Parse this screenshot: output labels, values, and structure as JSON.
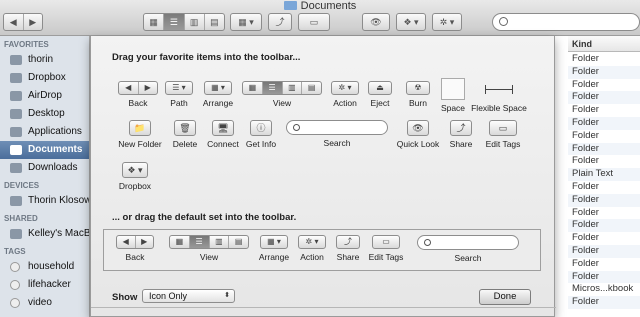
{
  "window": {
    "title": "Documents"
  },
  "toolbar": {
    "back_forward": [
      "◀",
      "▶"
    ],
    "view_modes": [
      "▦",
      "☰",
      "▥",
      "▤"
    ],
    "arrange_label": "▦ ▾",
    "share_label": "⤴",
    "tags_label": "▭",
    "quicklook_label": "👁",
    "dropbox_label": "❖ ▾",
    "action_label": "✲ ▾"
  },
  "sidebar": {
    "favorites_header": "FAVORITES",
    "favorites": [
      {
        "label": "thorin"
      },
      {
        "label": "Dropbox"
      },
      {
        "label": "AirDrop"
      },
      {
        "label": "Desktop"
      },
      {
        "label": "Applications"
      },
      {
        "label": "Documents"
      },
      {
        "label": "Downloads"
      }
    ],
    "devices_header": "DEVICES",
    "devices": [
      {
        "label": "Thorin Klosow..."
      }
    ],
    "shared_header": "SHARED",
    "shared": [
      {
        "label": "Kelley's MacBo..."
      }
    ],
    "tags_header": "TAGS",
    "tags": [
      {
        "label": "household"
      },
      {
        "label": "lifehacker"
      },
      {
        "label": "video"
      }
    ]
  },
  "list": {
    "kind_header": "Kind",
    "kinds": [
      "Folder",
      "Folder",
      "Folder",
      "Folder",
      "Folder",
      "Folder",
      "Folder",
      "Folder",
      "Folder",
      "Plain Text",
      "Folder",
      "Folder",
      "Folder",
      "Folder",
      "Folder",
      "Folder",
      "Folder",
      "Folder",
      "Micros...kbook",
      "Folder"
    ]
  },
  "customize": {
    "heading": "Drag your favorite items into the toolbar...",
    "default_heading": "... or drag the default set into the toolbar.",
    "items": {
      "back": "Back",
      "path": "Path",
      "arrange": "Arrange",
      "view": "View",
      "action": "Action",
      "eject": "Eject",
      "burn": "Burn",
      "space": "Space",
      "flexible_space": "Flexible Space",
      "new_folder": "New Folder",
      "delete": "Delete",
      "connect": "Connect",
      "get_info": "Get Info",
      "search": "Search",
      "quick_look": "Quick Look",
      "share": "Share",
      "edit_tags": "Edit Tags",
      "dropbox": "Dropbox"
    },
    "icons": {
      "back": [
        "◀",
        "▶"
      ],
      "path": "☰ ▾",
      "arrange": "▦ ▾",
      "view": [
        "▦",
        "☰",
        "▥",
        "▤"
      ],
      "action": "✲ ▾",
      "eject": "⏏",
      "burn": "☢",
      "new_folder": "📁",
      "delete": "🗑",
      "connect": "🖥",
      "get_info": "ⓘ",
      "quick_look": "👁",
      "share": "⤴",
      "edit_tags": "▭",
      "dropbox": "❖ ▾"
    },
    "show_label": "Show",
    "show_value": "Icon Only",
    "done_label": "Done"
  }
}
